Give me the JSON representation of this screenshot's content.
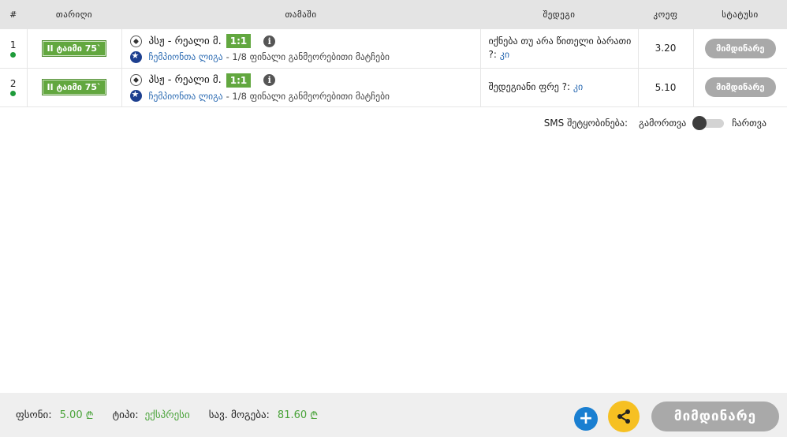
{
  "table": {
    "headers": [
      "#",
      "თარიღი",
      "თამაში",
      "შედეგი",
      "კოეფ",
      "სტატუსი"
    ],
    "rows": [
      {
        "number": "1",
        "time": "II ტაიმი 75`",
        "teams": "პსჟ - რეალი მ.",
        "score": "1:1",
        "league": "ჩემპიონთა ლიგა",
        "stage": "- 1/8 ფინალი განმეორებითი მატჩები",
        "bet_text": "იქნება თუ არა წითელი ბარათი ?:",
        "bet_choice": "კი",
        "odds": "3.20",
        "status": "მიმდინარე"
      },
      {
        "number": "2",
        "time": "II ტაიმი 75`",
        "teams": "პსჟ - რეალი მ.",
        "score": "1:1",
        "league": "ჩემპიონთა ლიგა",
        "stage": "- 1/8 ფინალი განმეორებითი მატჩები",
        "bet_text": "შედეგიანი ფრე ?:",
        "bet_choice": "კი",
        "odds": "5.10",
        "status": "მიმდინარე"
      }
    ]
  },
  "sms": {
    "label": "SMS შეტყობინება:",
    "off": "გამორთვა",
    "on": "ჩართვა",
    "state": "off"
  },
  "footer": {
    "stake_label": "ფსონი:",
    "stake_value": "5.00",
    "currency": "₾",
    "type_label": "ტიპი:",
    "type_value": "ექსპრესი",
    "win_label": "სავ. მოგება:",
    "win_value": "81.60",
    "status_button": "მიმდინარე",
    "plus": "+"
  },
  "colors": {
    "accent_green": "#62a73f",
    "link_blue": "#2d6cb3",
    "status_grey": "#a9a9a9",
    "share_yellow": "#f6c022",
    "plus_blue": "#1a7fd1"
  }
}
